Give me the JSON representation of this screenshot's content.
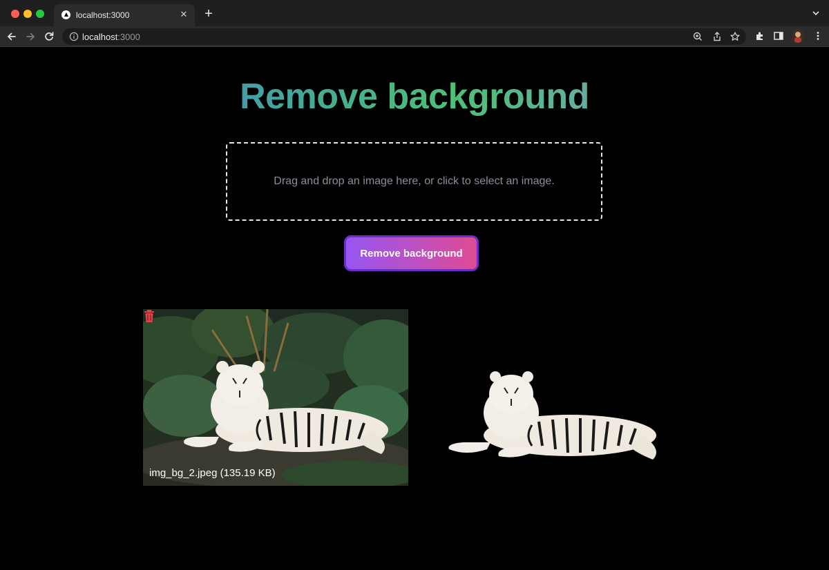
{
  "browser": {
    "tab_title": "localhost:3000",
    "url_host": "localhost",
    "url_port": ":3000"
  },
  "page": {
    "title": "Remove background",
    "dropzone_text": "Drag and drop an image here, or click to select an image.",
    "button_label": "Remove background",
    "file_label": "img_bg_2.jpeg (135.19 KB)"
  },
  "colors": {
    "background": "#000000",
    "button_start": "#9656f2",
    "button_end": "#df4b93",
    "trash": "#e0434a"
  },
  "icons": [
    "info-icon",
    "zoom-icon",
    "share-icon",
    "star-icon",
    "extensions-icon",
    "sidepanel-icon",
    "menu-icon",
    "trash-icon"
  ]
}
